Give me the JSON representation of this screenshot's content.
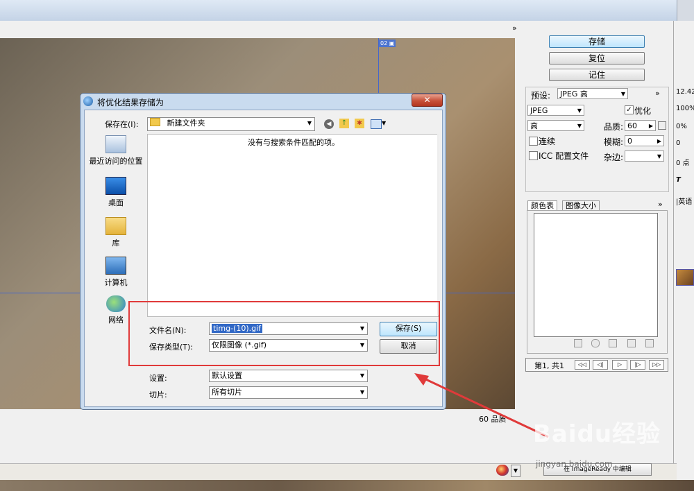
{
  "dialog": {
    "title": "将优化结果存储为",
    "close": "✕",
    "save_in_label": "保存在(I):",
    "folder": "新建文件夹",
    "empty_message": "没有与搜索条件匹配的项。",
    "places": [
      "最近访问的位置",
      "桌面",
      "库",
      "计算机",
      "网络"
    ],
    "filename_label": "文件名(N):",
    "filename_value": "timg-(10).gif",
    "filetype_label": "保存类型(T):",
    "filetype_value": "仅限图像 (*.gif)",
    "settings_label": "设置:",
    "settings_value": "默认设置",
    "slices_label": "切片:",
    "slices_value": "所有切片",
    "save_button": "保存(S)",
    "cancel_button": "取消"
  },
  "right_panel": {
    "save": "存储",
    "reset": "复位",
    "remember": "记住",
    "preset_label": "预设:",
    "preset_value": "JPEG 高",
    "format_value": "JPEG",
    "quality_level": "高",
    "optimize_label": "优化",
    "progressive_label": "连续",
    "icc_label": "ICC 配置文件",
    "quality_label": "品质:",
    "quality_value": "60",
    "blur_label": "模糊:",
    "blur_value": "0",
    "matte_label": "杂边:",
    "tab_color_table": "颜色表",
    "tab_image_size": "图像大小",
    "frame_label": "第1, 共1",
    "expand": "»"
  },
  "preview": {
    "slice_badge": "02",
    "status": "60 品质",
    "bottom_text": "在 ImageReady 中编辑"
  },
  "far_right": [
    "12.42",
    "100%",
    "0%",
    "0",
    "0 点",
    "T",
    "|英语"
  ],
  "watermark": {
    "brand": "Baidu经验",
    "url": "jingyan.baidu.com"
  }
}
